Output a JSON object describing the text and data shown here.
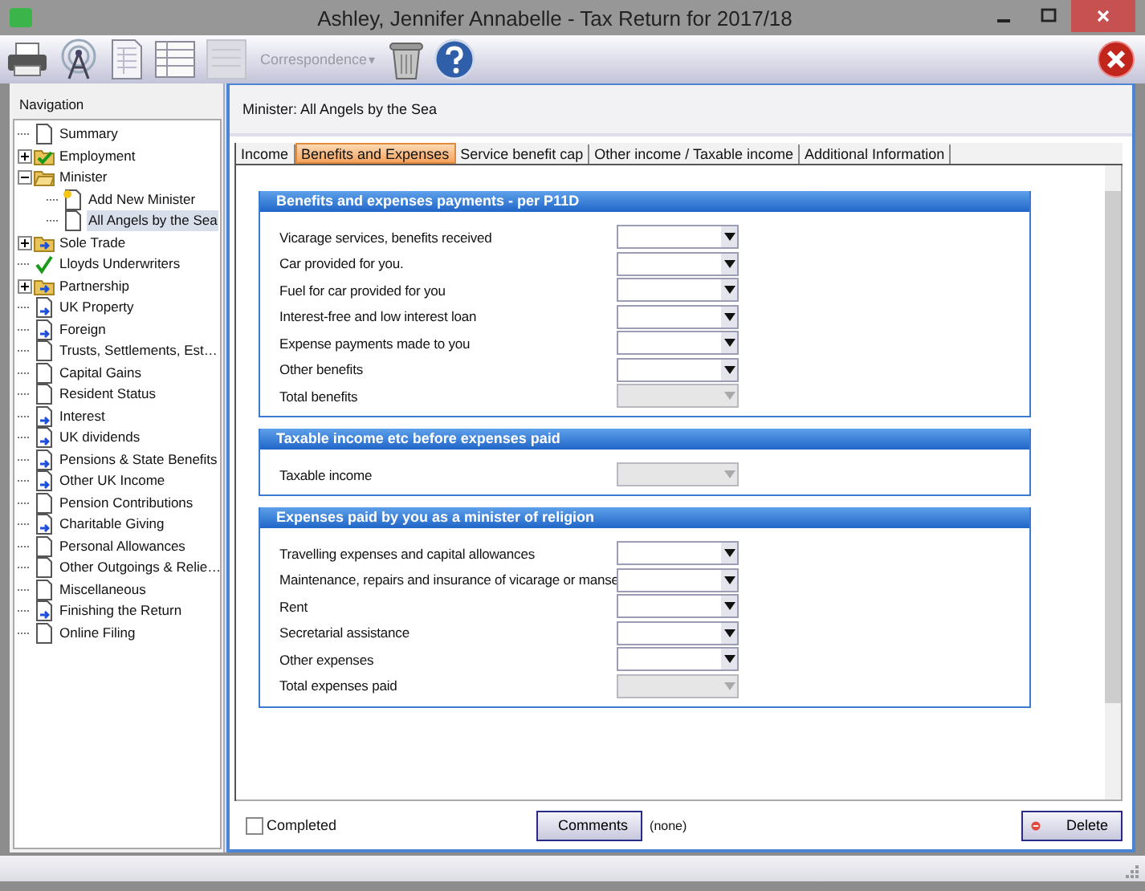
{
  "window": {
    "title": "Ashley, Jennifer Annabelle - Tax Return for 2017/18"
  },
  "toolbar": {
    "correspondence": {
      "label": "Correspondence",
      "caret": "▾",
      "disabled": true
    }
  },
  "navigation": {
    "title": "Navigation",
    "items": [
      {
        "label": "Summary",
        "kind": "page",
        "selected": false
      },
      {
        "label": "Employment",
        "kind": "folder-check",
        "selected": false,
        "expanded": false
      },
      {
        "label": "Minister",
        "kind": "folder-open",
        "selected": false,
        "expanded": true,
        "children": [
          {
            "label": "Add New Minister",
            "kind": "page-new",
            "selected": false
          },
          {
            "label": "All Angels by the Sea",
            "kind": "page",
            "selected": true
          }
        ]
      },
      {
        "label": "Sole Trade",
        "kind": "folder-arrow",
        "selected": false,
        "expanded": false
      },
      {
        "label": "Lloyds Underwriters",
        "kind": "check",
        "selected": false
      },
      {
        "label": "Partnership",
        "kind": "folder-arrow",
        "selected": false,
        "expanded": false
      },
      {
        "label": "UK Property",
        "kind": "page-arrow",
        "selected": false
      },
      {
        "label": "Foreign",
        "kind": "page-arrow",
        "selected": false
      },
      {
        "label": "Trusts, Settlements, Est…",
        "kind": "page",
        "selected": false
      },
      {
        "label": "Capital Gains",
        "kind": "page",
        "selected": false
      },
      {
        "label": "Resident Status",
        "kind": "page",
        "selected": false
      },
      {
        "label": "Interest",
        "kind": "page-arrow",
        "selected": false
      },
      {
        "label": "UK dividends",
        "kind": "page-arrow",
        "selected": false
      },
      {
        "label": "Pensions & State Benefits",
        "kind": "page-arrow",
        "selected": false
      },
      {
        "label": "Other UK Income",
        "kind": "page-arrow",
        "selected": false
      },
      {
        "label": "Pension Contributions",
        "kind": "page",
        "selected": false
      },
      {
        "label": "Charitable Giving",
        "kind": "page-arrow",
        "selected": false
      },
      {
        "label": "Personal Allowances",
        "kind": "page",
        "selected": false
      },
      {
        "label": "Other Outgoings & Relie…",
        "kind": "page",
        "selected": false
      },
      {
        "label": "Miscellaneous",
        "kind": "page",
        "selected": false
      },
      {
        "label": "Finishing the Return",
        "kind": "page-arrow",
        "selected": false
      },
      {
        "label": "Online Filing",
        "kind": "page",
        "selected": false
      }
    ]
  },
  "main": {
    "heading": "Minister: All Angels by the Sea",
    "tabs": [
      {
        "label": "Income",
        "selected": false
      },
      {
        "label": "Benefits and Expenses",
        "selected": true
      },
      {
        "label": "Service benefit cap",
        "selected": false
      },
      {
        "label": "Other income / Taxable income",
        "selected": false
      },
      {
        "label": "Additional Information",
        "selected": false
      }
    ],
    "sections": [
      {
        "title": "Benefits and expenses payments - per P11D",
        "rows": [
          {
            "label": "Vicarage services, benefits received",
            "disabled": false
          },
          {
            "label": "Car provided for you.",
            "disabled": false
          },
          {
            "label": "Fuel for car provided for you",
            "disabled": false
          },
          {
            "label": "Interest-free and low interest loan",
            "disabled": false
          },
          {
            "label": "Expense payments made to you",
            "disabled": false
          },
          {
            "label": "Other benefits",
            "disabled": false
          },
          {
            "label": "Total benefits",
            "disabled": true
          }
        ]
      },
      {
        "title": "Taxable income etc before expenses paid",
        "rows": [
          {
            "label": "Taxable income",
            "disabled": true
          }
        ]
      },
      {
        "title": "Expenses paid by you as a minister of religion",
        "rows": [
          {
            "label": "Travelling expenses and capital allowances",
            "disabled": false
          },
          {
            "label": "Maintenance, repairs and insurance of vicarage or manse",
            "disabled": false
          },
          {
            "label": "Rent",
            "disabled": false
          },
          {
            "label": "Secretarial assistance",
            "disabled": false
          },
          {
            "label": "Other expenses",
            "disabled": false
          },
          {
            "label": "Total expenses paid",
            "disabled": true
          }
        ]
      }
    ],
    "completed": {
      "label": "Completed",
      "checked": false
    },
    "comments": {
      "button": "Comments",
      "value": "(none)"
    },
    "delete": {
      "button": "Delete"
    }
  }
}
